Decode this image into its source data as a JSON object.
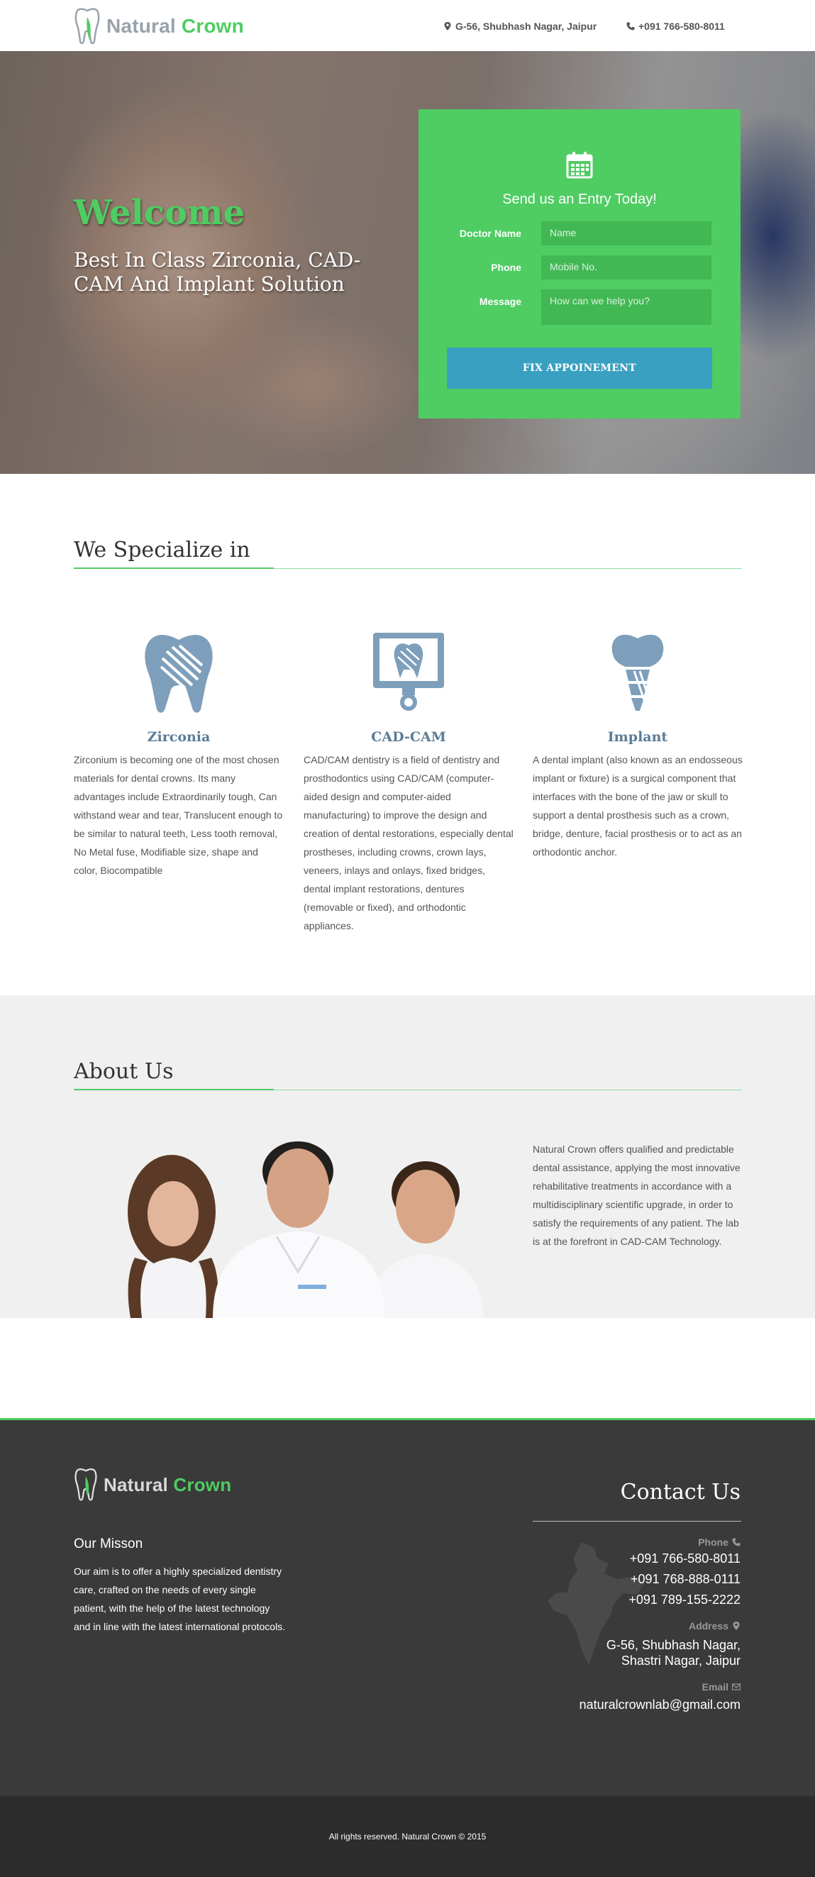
{
  "brand": {
    "name_part1": "Natural",
    "name_part2": "Crown",
    "accent": "#4fcc62",
    "blue": "#3aa0c2"
  },
  "topbar": {
    "address": "G-56, Shubhash Nagar, Jaipur",
    "address_icon": "map-marker-icon",
    "phone": "+091 766-580-8011",
    "phone_icon": "phone-icon"
  },
  "hero": {
    "welcome": "Welcome",
    "subtitle": "Best In Class Zirconia, CAD-CAM And Implant Solution"
  },
  "form": {
    "icon": "calendar-icon",
    "title": "Send us an Entry Today!",
    "doctor_label": "Doctor Name",
    "doctor_placeholder": "Name",
    "phone_label": "Phone",
    "phone_placeholder": "Mobile No.",
    "message_label": "Message",
    "message_placeholder": "How can we help you?",
    "submit": "FIX APPOINEMENT"
  },
  "specialize": {
    "title": "We Specialize in",
    "items": [
      {
        "icon": "tooth-icon",
        "title": "Zirconia",
        "text": "Zirconium is becoming one of the most chosen materials for dental crowns. Its many advantages include Extraordinarily tough, Can withstand wear and tear, Translucent enough to be similar to natural teeth, Less tooth removal, No Metal fuse, Modifiable size, shape and color, Biocompatible"
      },
      {
        "icon": "monitor-tooth-icon",
        "title": "CAD-CAM",
        "text": "CAD/CAM dentistry is a field of dentistry and prosthodontics using CAD/CAM (computer-aided design and computer-aided manufacturing) to improve the design and creation of dental restorations, especially dental prostheses, including crowns, crown lays, veneers, inlays and onlays, fixed bridges, dental implant restorations, dentures (removable or fixed), and orthodontic appliances."
      },
      {
        "icon": "implant-icon",
        "title": "Implant",
        "text": "A dental implant (also known as an endosseous implant or fixture) is a surgical component that interfaces with the bone of the jaw or skull to support a dental prosthesis such as a crown, bridge, denture, facial prosthesis or to act as an orthodontic anchor."
      }
    ]
  },
  "about": {
    "title": "About Us",
    "text": "Natural Crown offers qualified and predictable dental assistance, applying the most innovative rehabilitative treatments in accordance with a multidisciplinary scientific upgrade, in order to satisfy the requirements of any patient. The lab is at the forefront in CAD-CAM Technology."
  },
  "footer": {
    "mission_title": "Our Misson",
    "mission_text": "Our aim is to offer a highly specialized dentistry care, crafted on the needs of every single patient, with the help of the latest technology and in line with the latest international protocols.",
    "contact_title": "Contact Us",
    "phone_label": "Phone",
    "phones": [
      "+091 766-580-8011",
      "+091 768-888-0111",
      "+091 789-155-2222"
    ],
    "address_label": "Address",
    "address_line1": "G-56, Shubhash Nagar,",
    "address_line2": "Shastri Nagar, Jaipur",
    "email_label": "Email",
    "email": "naturalcrownlab@gmail.com",
    "copyright": "All rights reserved. Natural Crown © 2015"
  }
}
